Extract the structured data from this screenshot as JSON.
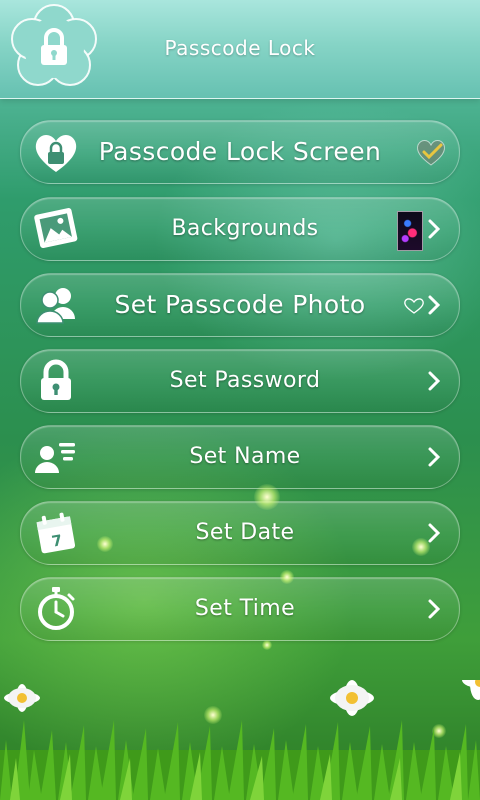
{
  "header": {
    "title": "Passcode Lock",
    "logo_icon": "lock-icon"
  },
  "menu": {
    "items": [
      {
        "label": "Passcode Lock Screen",
        "icon": "heart-lock-icon",
        "status": "checked"
      },
      {
        "label": "Backgrounds",
        "icon": "image-icon"
      },
      {
        "label": "Set Passcode Photo",
        "icon": "users-icon"
      },
      {
        "label": "Set Password",
        "icon": "lock-icon"
      },
      {
        "label": "Set Name",
        "icon": "user-card-icon"
      },
      {
        "label": "Set Date",
        "icon": "calendar-icon",
        "calendar_day": "7"
      },
      {
        "label": "Set Time",
        "icon": "stopwatch-icon"
      }
    ]
  },
  "colors": {
    "header_top": "#a9e6dd",
    "header_bottom": "#66c1b1",
    "background_green": "#2c8f4e",
    "accent_gold": "#e8c640"
  }
}
